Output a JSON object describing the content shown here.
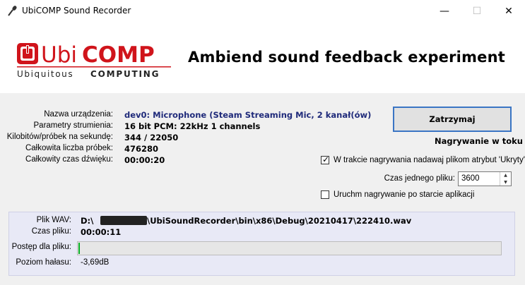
{
  "window": {
    "title": "UbiCOMP Sound Recorder",
    "min_glyph": "—",
    "max_glyph": "☐",
    "close_glyph": "✕"
  },
  "header": {
    "logo_main_prefix": "Ubi",
    "logo_main_suffix": "COMP",
    "logo_sub_left": "Ubiquitous",
    "logo_sub_right": "COMPUTING",
    "headline": "Ambiend sound feedback experiment",
    "brand_color": "#d0141b"
  },
  "device": {
    "device_name_label": "Nazwa urządzenia:",
    "device_name_value": "dev0: Microphone (Steam Streaming Mic, 2 kanał(ów)",
    "stream_params_label": "Parametry strumienia:",
    "stream_params_value": "16 bit PCM: 22kHz 1 channels",
    "kbps_label": "Kilobitów/próbek na sekundę:",
    "kbps_value": "344 / 22050",
    "total_samples_label": "Całkowita liczba próbek:",
    "total_samples_value": "476280",
    "total_time_label": "Całkowity czas dźwięku:",
    "total_time_value": "00:00:20"
  },
  "controls": {
    "stop_button": "Zatrzymaj",
    "recording_status": "Nagrywanie w toku",
    "hidden_attr_checkbox_label": "W trakcie nagrywania nadawaj plikom atrybut 'Ukryty'",
    "hidden_attr_checked": true,
    "file_duration_label": "Czas jednego pliku:",
    "file_duration_value": "3600",
    "autostart_checkbox_label": "Uruchm nagrywanie po starcie aplikacji",
    "autostart_checked": false
  },
  "file": {
    "wav_label": "Plik WAV:",
    "wav_prefix": "D:\\",
    "wav_suffix": "\\UbiSoundRecorder\\bin\\x86\\Debug\\20210417\\222410.wav",
    "file_time_label": "Czas pliku:",
    "file_time_value": "00:00:11",
    "progress_label": "Postęp dla pliku:",
    "progress_fraction": 0.003,
    "noise_label": "Poziom hałasu:",
    "noise_value": "-3,69dB"
  }
}
